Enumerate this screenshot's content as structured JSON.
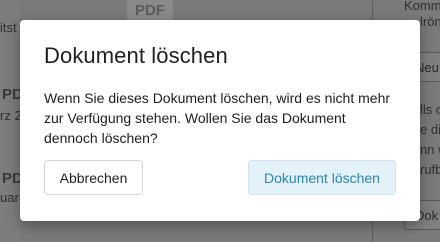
{
  "background": {
    "left_texts": [
      "PDF",
      "itst",
      "PDF",
      "rz 2",
      "PDF",
      "uar"
    ],
    "right_texts": [
      "Komm",
      "lrön",
      "Neu",
      "lls c",
      "e die",
      "nn w",
      "rufbu",
      "Dok"
    ],
    "pdf_card_label": "PDF"
  },
  "dialog": {
    "title": "Dokument löschen",
    "message": "Wenn Sie dieses Dokument löschen, wird es nicht mehr zur Verfügung stehen. Wollen Sie das Dokument dennoch löschen?",
    "cancel_label": "Abbrechen",
    "confirm_label": "Dokument löschen"
  },
  "colors": {
    "overlay": "#7a7a7a",
    "dialog_bg": "#ffffff",
    "confirm_bg": "#e3f1f9",
    "confirm_text": "#2a86b6"
  }
}
